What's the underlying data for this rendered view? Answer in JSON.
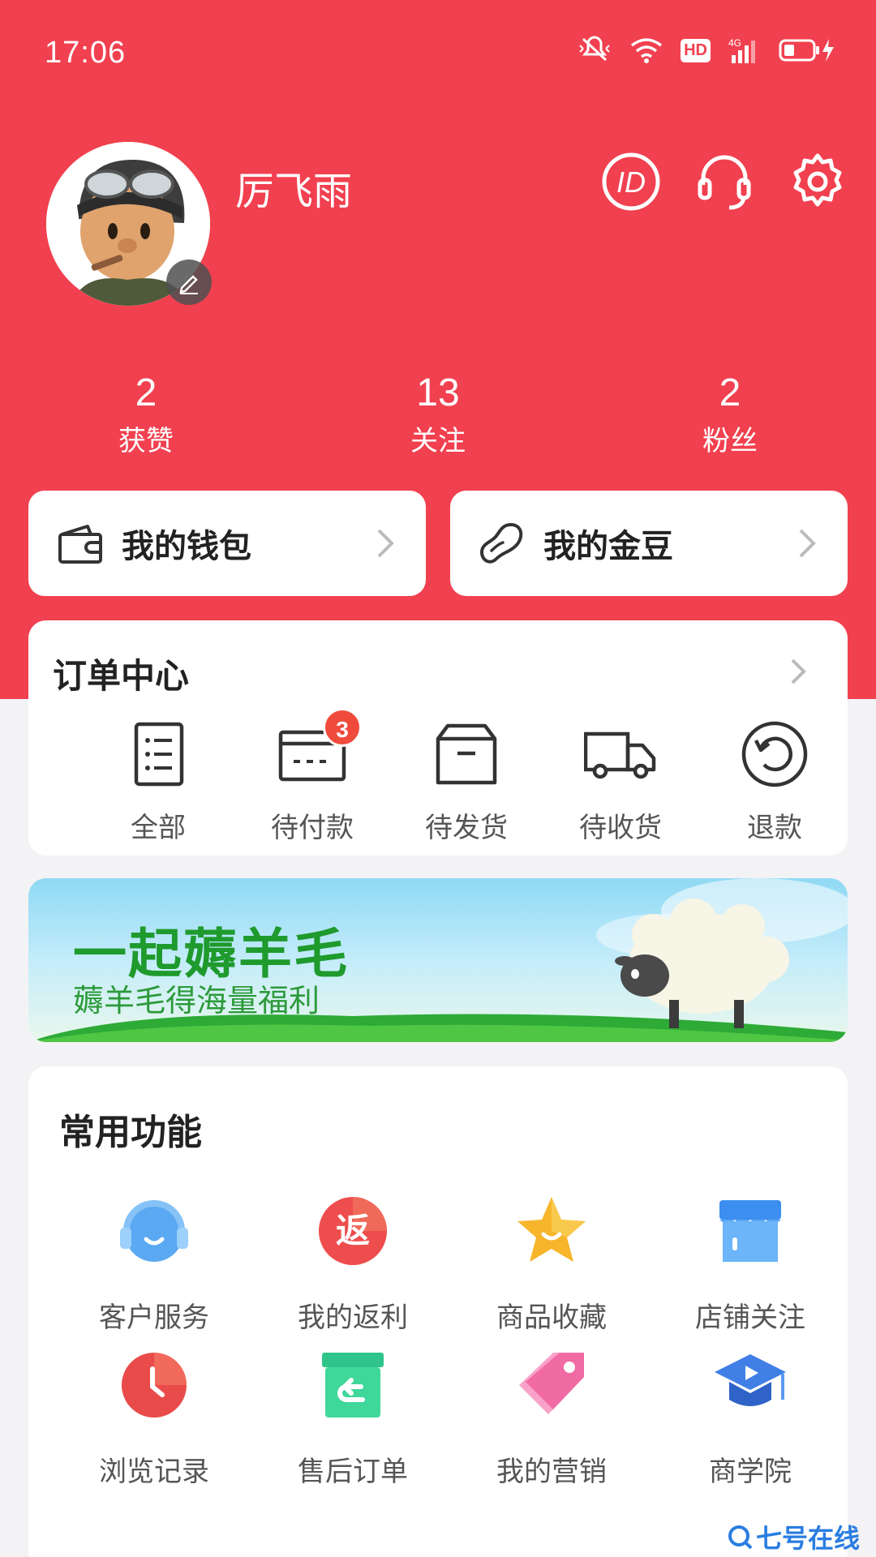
{
  "status_bar": {
    "time": "17:06",
    "hd": "HD",
    "network": "4G"
  },
  "profile": {
    "username": "厉飞雨"
  },
  "stats": [
    {
      "value": "2",
      "label": "获赞"
    },
    {
      "value": "13",
      "label": "关注"
    },
    {
      "value": "2",
      "label": "粉丝"
    }
  ],
  "cards": {
    "wallet": "我的钱包",
    "beans": "我的金豆"
  },
  "orders": {
    "title": "订单中心",
    "items": [
      {
        "label": "全部"
      },
      {
        "label": "待付款",
        "badge": "3"
      },
      {
        "label": "待发货"
      },
      {
        "label": "待收货"
      },
      {
        "label": "退款"
      }
    ]
  },
  "banner": {
    "title": "一起薅羊毛",
    "subtitle": "薅羊毛得海量福利"
  },
  "functions": {
    "title": "常用功能",
    "items": [
      {
        "label": "客户服务",
        "icon": "headset-icon"
      },
      {
        "label": "我的返利",
        "icon": "rebate-icon",
        "glyph": "返"
      },
      {
        "label": "商品收藏",
        "icon": "star-icon"
      },
      {
        "label": "店铺关注",
        "icon": "store-icon"
      },
      {
        "label": "浏览记录",
        "icon": "clock-icon"
      },
      {
        "label": "售后订单",
        "icon": "return-box-icon"
      },
      {
        "label": "我的营销",
        "icon": "tag-icon"
      },
      {
        "label": "商学院",
        "icon": "graduation-cap-icon"
      }
    ]
  },
  "watermark": "七号在线",
  "colors": {
    "brand_red": "#f1404f",
    "badge_red": "#ef4a3c",
    "banner_green": "#1f9a2d"
  }
}
